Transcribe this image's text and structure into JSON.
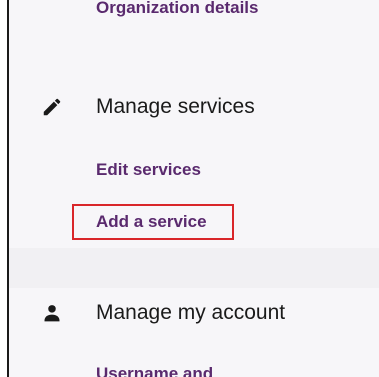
{
  "nav": {
    "org_details_label": "Organization details",
    "manage_services": {
      "heading": "Manage services",
      "icon": "pencil-icon",
      "links": [
        {
          "label": "Edit services"
        },
        {
          "label": "Add a service"
        }
      ]
    },
    "manage_account": {
      "heading": "Manage my account",
      "icon": "person-icon",
      "links": [
        {
          "label": "Username and"
        }
      ]
    }
  },
  "colors": {
    "link": "#5a2a6e",
    "heading": "#1a1a1a",
    "highlight": "#d9262a",
    "panel_bg": "#f7f6f9"
  }
}
